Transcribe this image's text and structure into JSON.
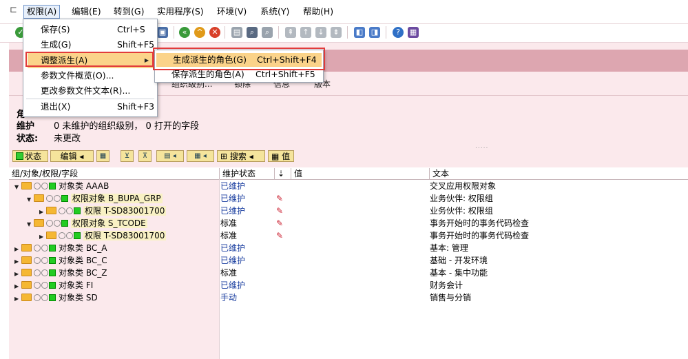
{
  "menubar": {
    "items": [
      {
        "label": "权限(A)",
        "active": true
      },
      {
        "label": "编辑(E)"
      },
      {
        "label": "转到(G)"
      },
      {
        "label": "实用程序(S)"
      },
      {
        "label": "环境(V)"
      },
      {
        "label": "系统(Y)"
      },
      {
        "label": "帮助(H)"
      }
    ]
  },
  "dropdown": {
    "items": [
      {
        "label": "保存(S)",
        "shortcut": "Ctrl+S"
      },
      {
        "label": "生成(G)",
        "shortcut": "Shift+F5"
      },
      {
        "label": "调整派生(A)",
        "shortcut": "",
        "submenu": true
      },
      {
        "label": "参数文件概览(O)...",
        "shortcut": ""
      },
      {
        "label": "更改参数文件文本(R)...",
        "shortcut": ""
      },
      {
        "label": "退出(X)",
        "shortcut": "Shift+F3"
      }
    ]
  },
  "submenu": {
    "items": [
      {
        "label": "生成派生的角色(G)",
        "shortcut": "Ctrl+Shift+F4"
      },
      {
        "label": "保存派生的角色(A)",
        "shortcut": "Ctrl+Shift+F5"
      }
    ]
  },
  "subtoolbar": {
    "visible_texts": [
      "组织级别...",
      "锁除",
      "信息",
      "版本"
    ]
  },
  "info": {
    "header_char": "角",
    "maintain_label": "维护",
    "maintain_value": "0 未维护的组织级别，  0 打开的字段",
    "status_label": "状态:",
    "status_value": "未更改"
  },
  "gridbar": {
    "status_btn": "状态",
    "edit_btn": "编辑",
    "search_btn": "搜索",
    "value_btn": "值"
  },
  "grid": {
    "headers": [
      "组/对象/权限/字段",
      "维护状态",
      "",
      "值",
      "文本"
    ],
    "rows": [
      {
        "arrow": "▼",
        "indent": 0,
        "prefix": "对象类",
        "name": "AAAB",
        "status": "已维护",
        "status_kind": "blue",
        "edit": false,
        "text": "交叉应用权限对象"
      },
      {
        "arrow": "▼",
        "indent": 1,
        "prefix": "权限对象",
        "name": "B_BUPA_GRP",
        "status": "已维护",
        "status_kind": "blue",
        "edit": true,
        "text": "业务伙伴: 权限组",
        "selected": true
      },
      {
        "arrow": "▶",
        "indent": 2,
        "prefix": "权限",
        "name": "T-SD83001700",
        "status": "已维护",
        "status_kind": "blue",
        "edit": true,
        "text": "业务伙伴: 权限组",
        "selected": true
      },
      {
        "arrow": "▼",
        "indent": 1,
        "prefix": "权限对象",
        "name": "S_TCODE",
        "status": "标准",
        "status_kind": "plain",
        "edit": true,
        "text": "事务开始时的事务代码检查",
        "selected": true
      },
      {
        "arrow": "▶",
        "indent": 2,
        "prefix": "权限",
        "name": "T-SD83001700",
        "status": "标准",
        "status_kind": "plain",
        "edit": true,
        "text": "事务开始时的事务代码检查",
        "selected": true
      },
      {
        "arrow": "▶",
        "indent": 0,
        "prefix": "对象类",
        "name": "BC_A",
        "status": "已维护",
        "status_kind": "blue",
        "edit": false,
        "text": "基本: 管理"
      },
      {
        "arrow": "▶",
        "indent": 0,
        "prefix": "对象类",
        "name": "BC_C",
        "status": "已维护",
        "status_kind": "blue",
        "edit": false,
        "text": "基础 - 开发环境"
      },
      {
        "arrow": "▶",
        "indent": 0,
        "prefix": "对象类",
        "name": "BC_Z",
        "status": "标准",
        "status_kind": "plain",
        "edit": false,
        "text": "基本 - 集中功能"
      },
      {
        "arrow": "▶",
        "indent": 0,
        "prefix": "对象类",
        "name": "FI",
        "status": "已维护",
        "status_kind": "blue",
        "edit": false,
        "text": "财务会计"
      },
      {
        "arrow": "▶",
        "indent": 0,
        "prefix": "对象类",
        "name": "SD",
        "status": "手动",
        "status_kind": "manual",
        "edit": false,
        "text": "销售与分销"
      }
    ]
  }
}
